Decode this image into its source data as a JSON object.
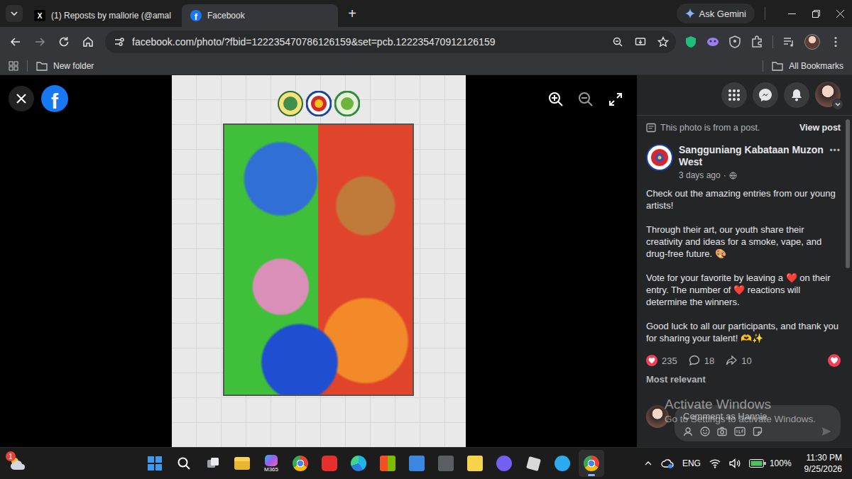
{
  "browser": {
    "tabs": [
      {
        "label": "(1) Reposts by mallorie (@amal",
        "kind": "x",
        "favicon": "X",
        "selected": false
      },
      {
        "label": "Facebook",
        "kind": "facebook",
        "favicon": "f",
        "selected": true
      }
    ],
    "new_tab": "+",
    "gemini": "Ask Gemini",
    "url": "facebook.com/photo/?fbid=122235470786126159&set=pcb.122235470912126159",
    "bookmarks": [
      {
        "label": "New folder"
      }
    ],
    "all_bookmarks": "All Bookmarks"
  },
  "viewer": {
    "logo": "f"
  },
  "panel": {
    "notice": "This photo is from a post.",
    "view_post": "View post",
    "post": {
      "page": "Sangguniang Kabataan Muzon West",
      "time": "3 days ago",
      "separator": "·",
      "more": "•••",
      "paragraphs": [
        "Check out the amazing entries from our young artists!",
        "Through their art, our youth share their creativity and ideas for a smoke, vape, and drug-free future. 🎨",
        "Vote for your favorite by leaving a ❤️ on their entry. The number of ❤️ reactions will determine the winners.",
        "Good luck to all our participants, and thank you for sharing your talent! 🫶✨"
      ]
    },
    "reactions": {
      "count": "235",
      "comments": "18",
      "shares": "10",
      "reacted": true
    },
    "sort": "Most relevant",
    "comment_placeholder": "Comment as Hannie"
  },
  "watermark": {
    "title": "Activate Windows",
    "subtitle": "Go to Settings to activate Windows."
  },
  "taskbar": {
    "weather_badge": "1",
    "apps": [
      {
        "kind": "start",
        "label": "",
        "active": false
      },
      {
        "kind": "search",
        "label": "",
        "active": false
      },
      {
        "kind": "taskview",
        "label": "",
        "active": false
      },
      {
        "kind": "explorer",
        "label": "",
        "active": false
      },
      {
        "kind": "copilot",
        "label": "M365",
        "active": false
      },
      {
        "kind": "chrome",
        "label": "",
        "active": false
      },
      {
        "kind": "wps",
        "label": "",
        "active": false
      },
      {
        "kind": "edge",
        "label": "",
        "active": false
      },
      {
        "kind": "store",
        "label": "",
        "active": false
      },
      {
        "kind": "notepad",
        "label": "",
        "active": false
      },
      {
        "kind": "calc",
        "label": "",
        "active": false
      },
      {
        "kind": "sticky",
        "label": "",
        "active": false
      },
      {
        "kind": "viber",
        "label": "",
        "active": false
      },
      {
        "kind": "roblox",
        "label": "",
        "active": false
      },
      {
        "kind": "telegram",
        "label": "",
        "active": false
      },
      {
        "kind": "chrome",
        "label": "",
        "active": true
      }
    ],
    "language": "ENG",
    "battery": "100%",
    "time": "11:30 PM",
    "date": "9/25/2026"
  }
}
